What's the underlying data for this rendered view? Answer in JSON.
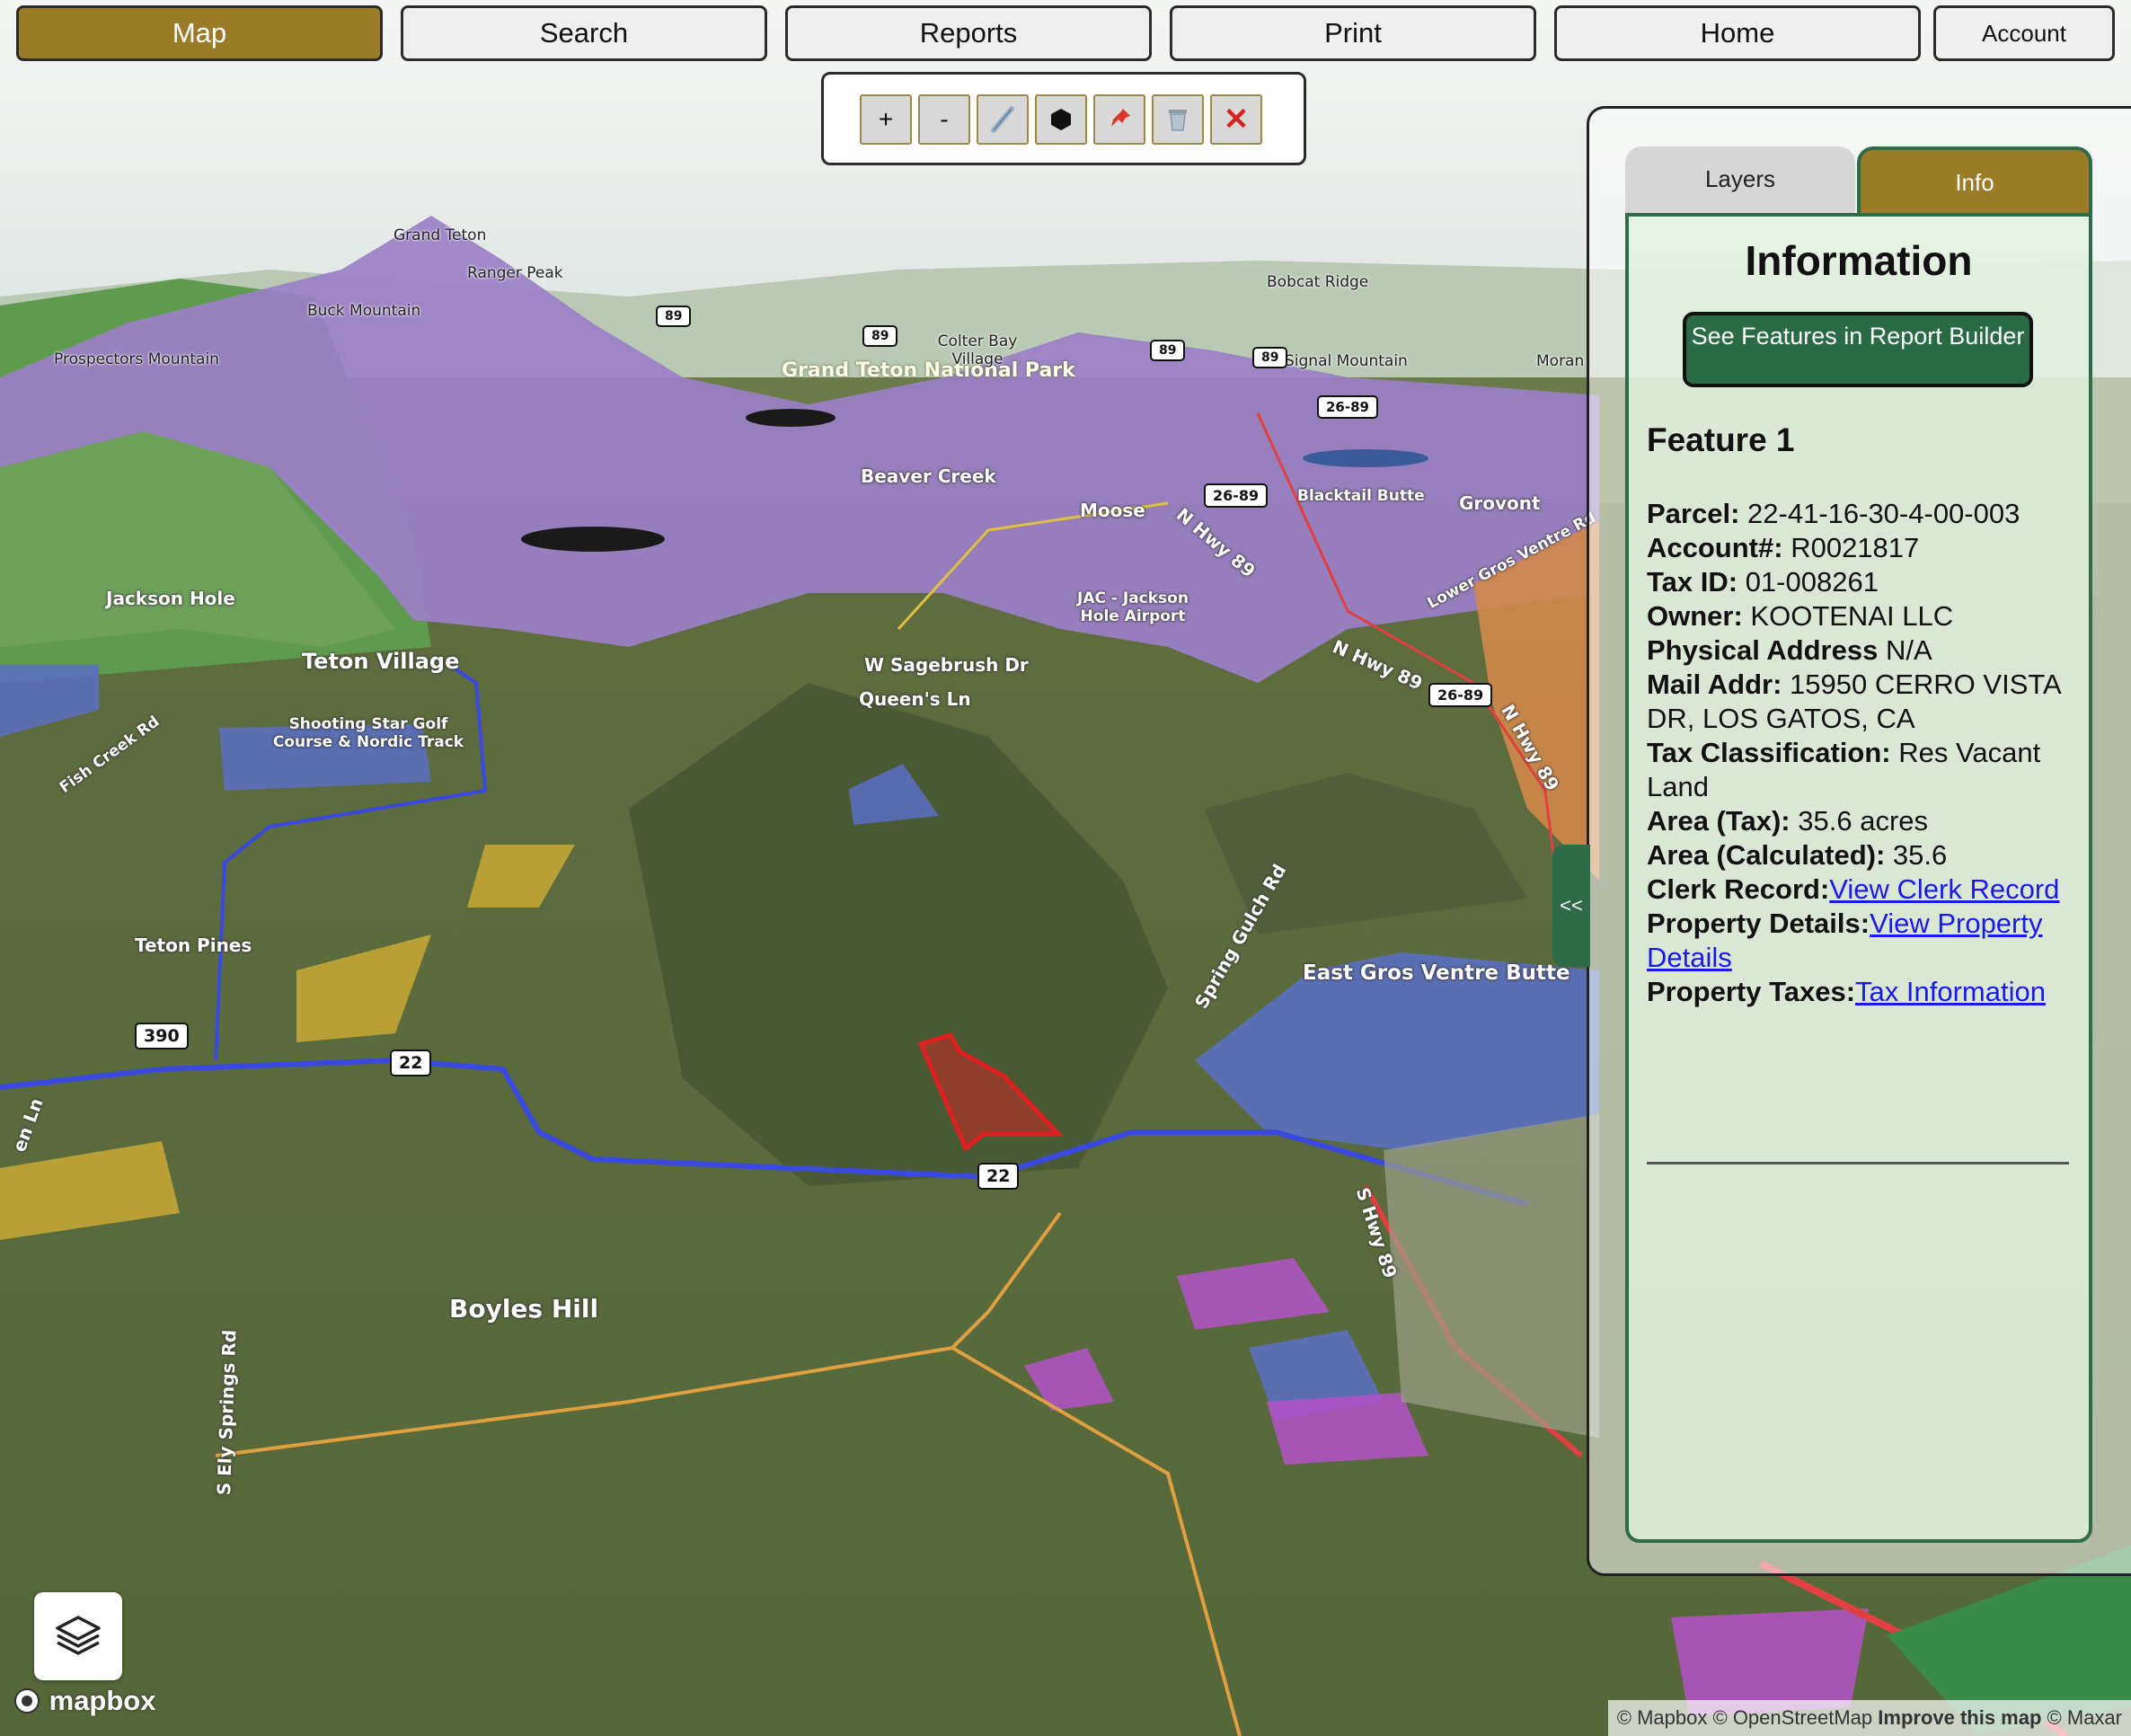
{
  "nav": {
    "map": "Map",
    "search": "Search",
    "reports": "Reports",
    "print": "Print",
    "home": "Home",
    "account": "Account",
    "active": "Map"
  },
  "toolbar": {
    "zoom_in": "+",
    "zoom_out": "-",
    "close": "✕",
    "tools": [
      "ruler-icon",
      "hexagon-icon",
      "pin-icon",
      "trash-icon",
      "close-icon"
    ]
  },
  "panel": {
    "tabs": {
      "layers": "Layers",
      "info": "Info"
    },
    "title": "Information",
    "report_button": "See Features in Report Builder",
    "collapse": "<<",
    "feature_heading": "Feature 1",
    "fields": {
      "parcel": {
        "label": "Parcel:",
        "value": "22-41-16-30-4-00-003"
      },
      "account": {
        "label": "Account#:",
        "value": "R0021817"
      },
      "tax_id": {
        "label": "Tax ID:",
        "value": "01-008261"
      },
      "owner": {
        "label": "Owner:",
        "value": "KOOTENAI LLC"
      },
      "physical_address": {
        "label": "Physical Address",
        "value": "N/A"
      },
      "mail_addr": {
        "label": "Mail Addr:",
        "value": "15950 CERRO VISTA DR, LOS GATOS, CA"
      },
      "tax_class": {
        "label": "Tax Classification:",
        "value": "Res Vacant Land"
      },
      "area_tax": {
        "label": "Area (Tax):",
        "value": "35.6 acres"
      },
      "area_calc": {
        "label": "Area (Calculated):",
        "value": "35.6"
      },
      "clerk": {
        "label": "Clerk Record:",
        "link": "View Clerk Record"
      },
      "property_details": {
        "label": "Property Details:",
        "link": "View Property Details"
      },
      "taxes": {
        "label": "Property Taxes:",
        "link": "Tax Information"
      }
    }
  },
  "map": {
    "labels": {
      "grand_teton": "Grand Teton",
      "ranger_peak": "Ranger Peak",
      "buck_mountain": "Buck Mountain",
      "prospectors": "Prospectors Mountain",
      "gtnp": "Grand Teton National Park",
      "colter_bay": "Colter Bay Village",
      "bobcat_ridge": "Bobcat Ridge",
      "signal_mountain": "Signal Mountain",
      "moran": "Moran",
      "beaver_creek": "Beaver Creek",
      "moose": "Moose",
      "blacktail_butte": "Blacktail Butte",
      "grovont": "Grovont",
      "jackson_hole": "Jackson Hole",
      "teton_village": "Teton Village",
      "jac_airport": "JAC - Jackson Hole Airport",
      "w_sagebrush": "W Sagebrush Dr",
      "queens_ln": "Queen's Ln",
      "n_hwy_89_a": "N Hwy 89",
      "n_hwy_89_b": "N Hwy 89",
      "n_hwy_89_c": "N Hwy 89",
      "lower_gros": "Lower Gros Ventre Rd",
      "shooting_star": "Shooting Star Golf Course & Nordic Track",
      "fish_creek": "Fish Creek Rd",
      "teton_pines": "Teton Pines",
      "spring_gulch": "Spring Gulch Rd",
      "east_gros": "East Gros Ventre Butte",
      "boyles_hill": "Boyles Hill",
      "s_ely": "S Ely Springs Rd",
      "s_hwy_89": "S Hwy 89",
      "en_ln": "en Ln"
    },
    "shields": {
      "s89a": "89",
      "s89b": "89",
      "s89c": "89",
      "s89d": "89",
      "s2689a": "26-89",
      "s2689b": "26-89",
      "s2689c": "26-89",
      "s390": "390",
      "s22a": "22",
      "s22b": "22"
    },
    "colors": {
      "selected_parcel": "#e02020",
      "national_park": "#9b7fc7",
      "zoning_blue": "#5a6fc4",
      "zoning_yellow": "#c9a935",
      "zoning_magenta": "#b452c8"
    }
  },
  "controls": {
    "layer_toggle_icon": "layers-icon",
    "mapbox_logo": "mapbox"
  },
  "attribution": {
    "mapbox": "© Mapbox",
    "osm": "© OpenStreetMap",
    "improve": "Improve this map",
    "maxar": "© Maxar"
  }
}
